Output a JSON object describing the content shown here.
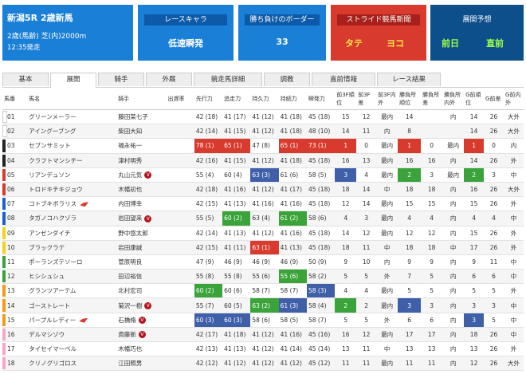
{
  "race": {
    "title": "新潟5R 2歳新馬",
    "condition": "2歳(馬齢) 芝(内)2000m",
    "time": "12:35発走"
  },
  "cards": {
    "chara": {
      "label": "レースキャラ",
      "value": "低速瞬発"
    },
    "border": {
      "label": "勝ち負けのボーダー",
      "value": "33"
    },
    "stride": {
      "label": "ストライド競馬新聞",
      "tate": "タテ",
      "yoko": "ヨコ"
    },
    "tenkai": {
      "label": "展開予想",
      "zenjitsu": "前日",
      "chokuzen": "直前"
    }
  },
  "tabs": [
    "基本",
    "展開",
    "騎手",
    "外厩",
    "競走馬詳細",
    "調教",
    "直前情報",
    "レース結果"
  ],
  "headers": [
    "馬番",
    "馬名",
    "騎手",
    "出遅率",
    "先行力",
    "追走力",
    "持久力",
    "持続力",
    "瞬発力",
    "前3F順位",
    "前3F差",
    "前3F内外",
    "勝負所順位",
    "勝負所差",
    "勝負所内外",
    "G前順位",
    "G前差",
    "G前内外"
  ],
  "rows": [
    {
      "no": "01",
      "name": "グリーンメーラー",
      "jockey": "藤田菜七子",
      "deokure": "",
      "s1": "42 (18)",
      "s2": "41 (17)",
      "s3": "41 (12)",
      "s4": "41 (18)",
      "s5": "45 (18)",
      "f1": "15",
      "f2": "12",
      "f3": "最内",
      "g1": "14",
      "g2": "",
      "g3": "内",
      "h1": "14",
      "h2": "26",
      "h3": "大外"
    },
    {
      "no": "02",
      "name": "アイングーブング",
      "jockey": "柴田大知",
      "deokure": "",
      "s1": "42 (14)",
      "s2": "41 (15)",
      "s3": "41 (12)",
      "s4": "41 (18)",
      "s5": "48 (10)",
      "f1": "14",
      "f2": "11",
      "f3": "内",
      "g1": "8",
      "g2": "",
      "g3": "",
      "h1": "14",
      "h2": "26",
      "h3": "大外"
    },
    {
      "no": "03",
      "name": "セブンサミット",
      "jockey": "福永祐一",
      "deokure": "",
      "s1": "78 (1)",
      "s2": "65 (1)",
      "s3": "47 (8)",
      "s4": "65 (1)",
      "s5": "73 (1)",
      "f1": "1",
      "f2": "0",
      "f3": "最内",
      "g1": "1",
      "g2": "0",
      "g3": "最内",
      "h1": "1",
      "h2": "0",
      "h3": "内"
    },
    {
      "no": "04",
      "name": "クラフトマンシチー",
      "jockey": "津村明秀",
      "deokure": "",
      "s1": "42 (16)",
      "s2": "41 (15)",
      "s3": "41 (12)",
      "s4": "41 (18)",
      "s5": "45 (18)",
      "f1": "16",
      "f2": "13",
      "f3": "最内",
      "g1": "16",
      "g2": "16",
      "g3": "内",
      "h1": "14",
      "h2": "26",
      "h3": "外"
    },
    {
      "no": "05",
      "name": "リアンデュソン",
      "jockey": "丸山元気",
      "deokure": "",
      "s1": "55 (4)",
      "s2": "60 (4)",
      "s3": "63 (3)",
      "s4": "61 (6)",
      "s5": "58 (5)",
      "f1": "3",
      "f2": "4",
      "f3": "最内",
      "g1": "2",
      "g2": "3",
      "g3": "最内",
      "h1": "2",
      "h2": "3",
      "h3": "中"
    },
    {
      "no": "06",
      "name": "トロドキチキジョウ",
      "jockey": "木幡初也",
      "deokure": "",
      "s1": "42 (18)",
      "s2": "41 (16)",
      "s3": "41 (12)",
      "s4": "41 (17)",
      "s5": "45 (18)",
      "f1": "18",
      "f2": "14",
      "f3": "中",
      "g1": "18",
      "g2": "18",
      "g3": "内",
      "h1": "16",
      "h2": "26",
      "h3": "大外"
    },
    {
      "no": "07",
      "name": "コトブキボラリス",
      "jockey": "内田博幸",
      "deokure": "",
      "s1": "42 (15)",
      "s2": "41 (13)",
      "s3": "41 (16)",
      "s4": "41 (16)",
      "s5": "45 (18)",
      "f1": "12",
      "f2": "14",
      "f3": "最内",
      "g1": "15",
      "g2": "15",
      "g3": "内",
      "h1": "15",
      "h2": "26",
      "h3": "外"
    },
    {
      "no": "08",
      "name": "タガノコハクゾラ",
      "jockey": "岩田望来",
      "deokure": "",
      "s1": "55 (5)",
      "s2": "60 (2)",
      "s3": "63 (4)",
      "s4": "61 (2)",
      "s5": "58 (6)",
      "f1": "4",
      "f2": "3",
      "f3": "最内",
      "g1": "4",
      "g2": "4",
      "g3": "内",
      "h1": "4",
      "h2": "4",
      "h3": "中"
    },
    {
      "no": "09",
      "name": "アンゼンダイチ",
      "jockey": "野中悠太郎",
      "deokure": "",
      "s1": "42 (14)",
      "s2": "41 (13)",
      "s3": "41 (12)",
      "s4": "41 (16)",
      "s5": "45 (18)",
      "f1": "14",
      "f2": "12",
      "f3": "最内",
      "g1": "12",
      "g2": "12",
      "g3": "内",
      "h1": "15",
      "h2": "26",
      "h3": "外"
    },
    {
      "no": "10",
      "name": "ブラックラテ",
      "jockey": "岩田康誠",
      "deokure": "",
      "s1": "42 (15)",
      "s2": "41 (11)",
      "s3": "63 (1)",
      "s4": "41 (13)",
      "s5": "45 (18)",
      "f1": "18",
      "f2": "11",
      "f3": "中",
      "g1": "18",
      "g2": "18",
      "g3": "中",
      "h1": "17",
      "h2": "26",
      "h3": "外"
    },
    {
      "no": "11",
      "name": "ポーランズテソーロ",
      "jockey": "菅原明良",
      "deokure": "",
      "s1": "47 (9)",
      "s2": "46 (9)",
      "s3": "46 (9)",
      "s4": "46 (9)",
      "s5": "50 (9)",
      "f1": "9",
      "f2": "10",
      "f3": "内",
      "g1": "9",
      "g2": "9",
      "g3": "内",
      "h1": "9",
      "h2": "11",
      "h3": "中"
    },
    {
      "no": "12",
      "name": "ヒシシュシュ",
      "jockey": "田辺裕信",
      "deokure": "",
      "s1": "55 (8)",
      "s2": "55 (8)",
      "s3": "55 (6)",
      "s4": "55 (6)",
      "s5": "58 (2)",
      "f1": "5",
      "f2": "5",
      "f3": "外",
      "g1": "7",
      "g2": "5",
      "g3": "内",
      "h1": "6",
      "h2": "6",
      "h3": "中"
    },
    {
      "no": "13",
      "name": "グランツアーテム",
      "jockey": "北村宏司",
      "deokure": "",
      "s1": "60 (2)",
      "s2": "60 (6)",
      "s3": "58 (7)",
      "s4": "58 (7)",
      "s5": "58 (3)",
      "f1": "4",
      "f2": "4",
      "f3": "最内",
      "g1": "5",
      "g2": "5",
      "g3": "内",
      "h1": "5",
      "h2": "5",
      "h3": "外"
    },
    {
      "no": "14",
      "name": "ゴーストレート",
      "jockey": "菊沢一樹",
      "deokure": "",
      "s1": "55 (7)",
      "s2": "60 (5)",
      "s3": "63 (2)",
      "s4": "61 (3)",
      "s5": "58 (4)",
      "f1": "2",
      "f2": "2",
      "f3": "最内",
      "g1": "3",
      "g2": "3",
      "g3": "内",
      "h1": "3",
      "h2": "3",
      "h3": "中"
    },
    {
      "no": "15",
      "name": "パープルレディー",
      "jockey": "石橋脩",
      "deokure": "",
      "s1": "60 (3)",
      "s2": "60 (3)",
      "s3": "58 (6)",
      "s4": "58 (5)",
      "s5": "58 (7)",
      "f1": "5",
      "f2": "5",
      "f3": "外",
      "g1": "6",
      "g2": "6",
      "g3": "内",
      "h1": "3",
      "h2": "5",
      "h3": "中"
    },
    {
      "no": "16",
      "name": "デルマシゾウ",
      "jockey": "斎藤新",
      "deokure": "",
      "s1": "42 (17)",
      "s2": "41 (18)",
      "s3": "41 (12)",
      "s4": "41 (16)",
      "s5": "45 (16)",
      "f1": "16",
      "f2": "12",
      "f3": "最内",
      "g1": "17",
      "g2": "17",
      "g3": "内",
      "h1": "18",
      "h2": "26",
      "h3": "中"
    },
    {
      "no": "17",
      "name": "タイセイマーベル",
      "jockey": "木幡巧也",
      "deokure": "",
      "s1": "42 (13)",
      "s2": "41 (13)",
      "s3": "41 (12)",
      "s4": "41 (14)",
      "s5": "45 (14)",
      "f1": "13",
      "f2": "11",
      "f3": "中",
      "g1": "13",
      "g2": "13",
      "g3": "内",
      "h1": "13",
      "h2": "26",
      "h3": "外"
    },
    {
      "no": "18",
      "name": "クリノグリゴロス",
      "jockey": "江田照男",
      "deokure": "",
      "s1": "42 (12)",
      "s2": "41 (12)",
      "s3": "41 (12)",
      "s4": "41 (12)",
      "s5": "45 (12)",
      "f1": "11",
      "f2": "11",
      "f3": "最内",
      "g1": "11",
      "g2": "11",
      "g3": "内",
      "h1": "12",
      "h2": "26",
      "h3": "大外"
    }
  ],
  "waku_colors": [
    "#ffffff",
    "#ffffff",
    "#222222",
    "#222222",
    "#d83a2e",
    "#d83a2e",
    "#1a5fd6",
    "#1a5fd6",
    "#f2d21a",
    "#f2d21a",
    "#3aa33a",
    "#3aa33a",
    "#f39a1a",
    "#f39a1a",
    "#f39a1a",
    "#f7a6c8",
    "#f7a6c8",
    "#f7a6c8"
  ],
  "colors": {
    "accent_blue": "#1a7fd6",
    "accent_red": "#d83a2e",
    "navy": "#0d4f8b"
  }
}
